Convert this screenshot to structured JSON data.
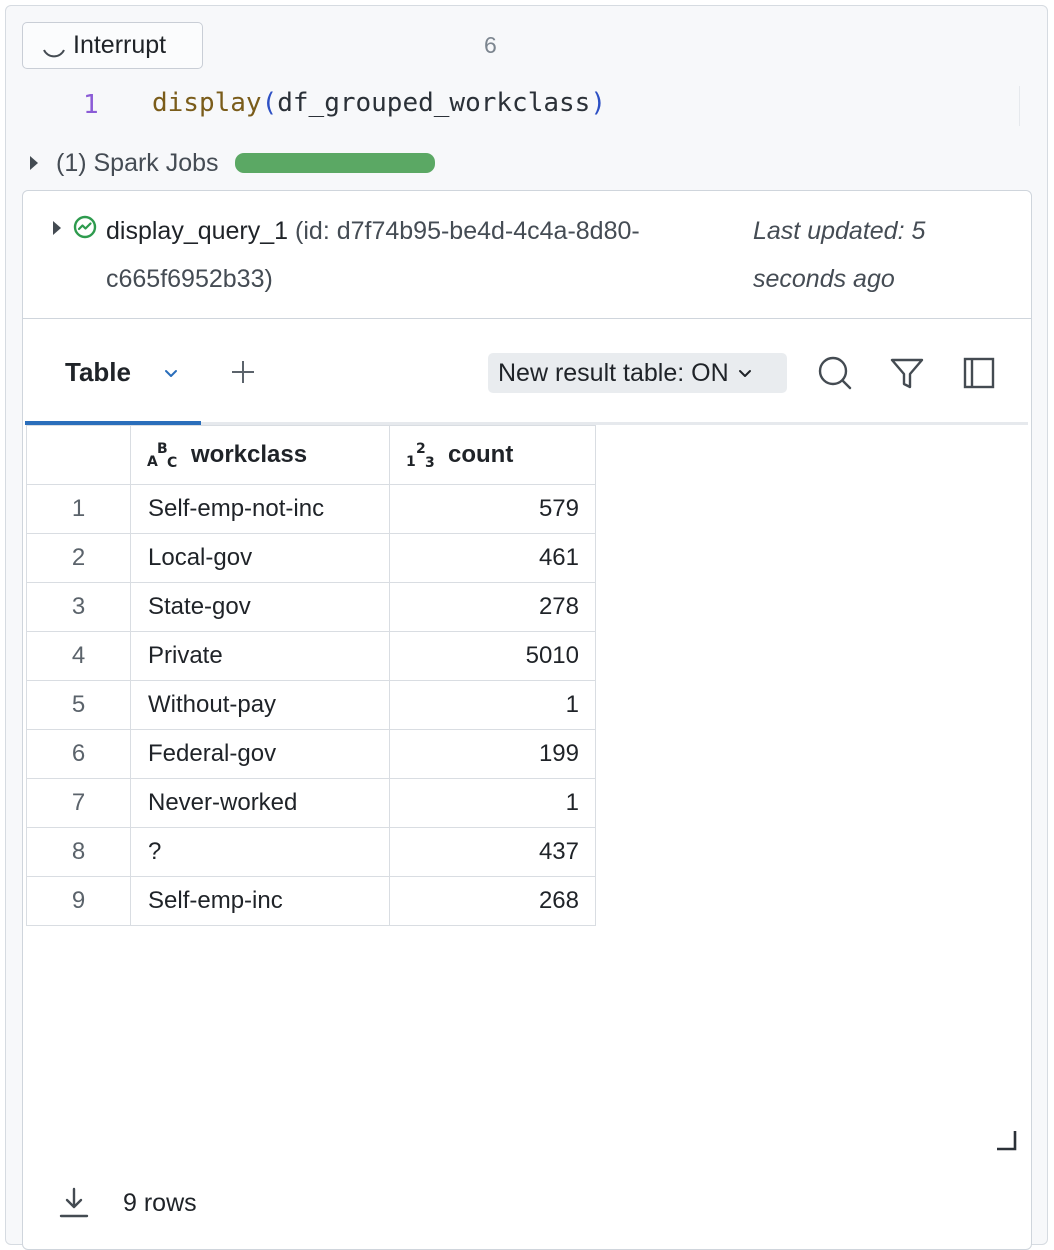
{
  "cell": {
    "interrupt_label": "Interrupt",
    "execution_count": "6",
    "code": {
      "line_number": "1",
      "function": "display",
      "open_paren": "(",
      "argument": "df_grouped_workclass",
      "close_paren": ")"
    },
    "spark_jobs_label": "(1) Spark Jobs",
    "spark_progress": 1.0
  },
  "query": {
    "name": "display_query_1",
    "id_text": "(id: d7f74b95-be4d-4c4a-8d80-c665f6952b33)",
    "last_updated": "Last updated: 5 seconds ago",
    "status_color": "#2e9b4e"
  },
  "tabs": {
    "active_label": "Table",
    "new_result_label": "New result table: ON"
  },
  "table": {
    "headers": {
      "workclass": "workclass",
      "count": "count"
    },
    "rows": [
      {
        "idx": "1",
        "workclass": "Self-emp-not-inc",
        "count": "579"
      },
      {
        "idx": "2",
        "workclass": "Local-gov",
        "count": "461"
      },
      {
        "idx": "3",
        "workclass": "State-gov",
        "count": "278"
      },
      {
        "idx": "4",
        "workclass": "Private",
        "count": "5010"
      },
      {
        "idx": "5",
        "workclass": "Without-pay",
        "count": "1"
      },
      {
        "idx": "6",
        "workclass": "Federal-gov",
        "count": "199"
      },
      {
        "idx": "7",
        "workclass": "Never-worked",
        "count": "1"
      },
      {
        "idx": "8",
        "workclass": "?",
        "count": "437"
      },
      {
        "idx": "9",
        "workclass": "Self-emp-inc",
        "count": "268"
      }
    ]
  },
  "footer": {
    "rows_label": "9 rows"
  },
  "colors": {
    "accent": "#2a6ebb",
    "progress": "#5ba864",
    "line_number": "#8b5cd6"
  }
}
